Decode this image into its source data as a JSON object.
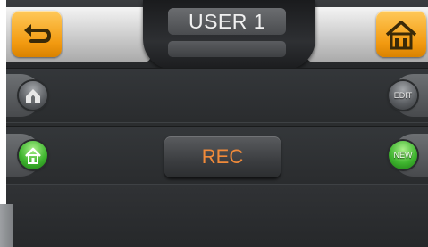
{
  "header": {
    "title": "USER 1",
    "back_icon": "back-arrow-icon",
    "home_icon": "home-icon"
  },
  "row1": {
    "left_icon": "home-gray-icon",
    "right_label": "EDIT"
  },
  "row2": {
    "left_icon": "home-green-icon",
    "center_label": "REC",
    "right_label": "NEW"
  },
  "colors": {
    "accent_orange": "#f29a10",
    "rec_text": "#f08a3a",
    "green": "#3fb52f"
  }
}
